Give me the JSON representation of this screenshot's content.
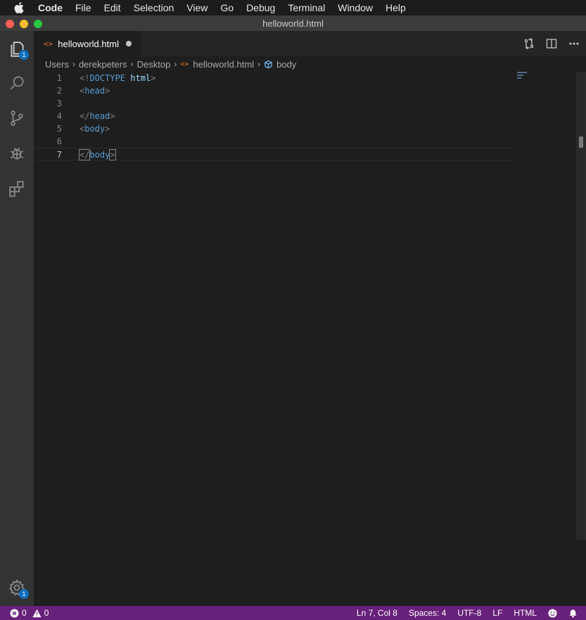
{
  "menubar": {
    "app": "Code",
    "items": [
      "File",
      "Edit",
      "Selection",
      "View",
      "Go",
      "Debug",
      "Terminal",
      "Window",
      "Help"
    ]
  },
  "window": {
    "title": "helloworld.html"
  },
  "activitybar": {
    "items": [
      {
        "name": "explorer",
        "icon": "files-icon",
        "badge": "1"
      },
      {
        "name": "search",
        "icon": "search-icon"
      },
      {
        "name": "source-control",
        "icon": "source-control-icon"
      },
      {
        "name": "debug",
        "icon": "debug-icon"
      },
      {
        "name": "extensions",
        "icon": "extensions-icon"
      }
    ],
    "settings_badge": "1"
  },
  "tab": {
    "label": "helloworld.html",
    "icon_text": "<>"
  },
  "breadcrumbs": {
    "items": [
      "Users",
      "derekpeters",
      "Desktop",
      "helloworld.html",
      "body"
    ],
    "html_icon_text": "<>"
  },
  "editor": {
    "current_line": 7,
    "lines": [
      {
        "num": "1",
        "open": "<!",
        "tag": "DOCTYPE",
        "attr": " html",
        "close": ">"
      },
      {
        "num": "2",
        "open": "<",
        "tag": "head",
        "close": ">"
      },
      {
        "num": "3"
      },
      {
        "num": "4",
        "open": "</",
        "tag": "head",
        "close": ">"
      },
      {
        "num": "5",
        "open": "<",
        "tag": "body",
        "close": ">"
      },
      {
        "num": "6"
      },
      {
        "num": "7",
        "open": "</",
        "tag": "body",
        "close": ">"
      }
    ]
  },
  "status": {
    "errors": "0",
    "warnings": "0",
    "position": "Ln 7, Col 8",
    "spaces": "Spaces: 4",
    "encoding": "UTF-8",
    "eol": "LF",
    "language": "HTML"
  },
  "colors": {
    "statusbar": "#68217a",
    "activitybar": "#333333",
    "editor_bg": "#1e1e1e",
    "tag": "#569cd6",
    "html_icon": "#e37933"
  }
}
